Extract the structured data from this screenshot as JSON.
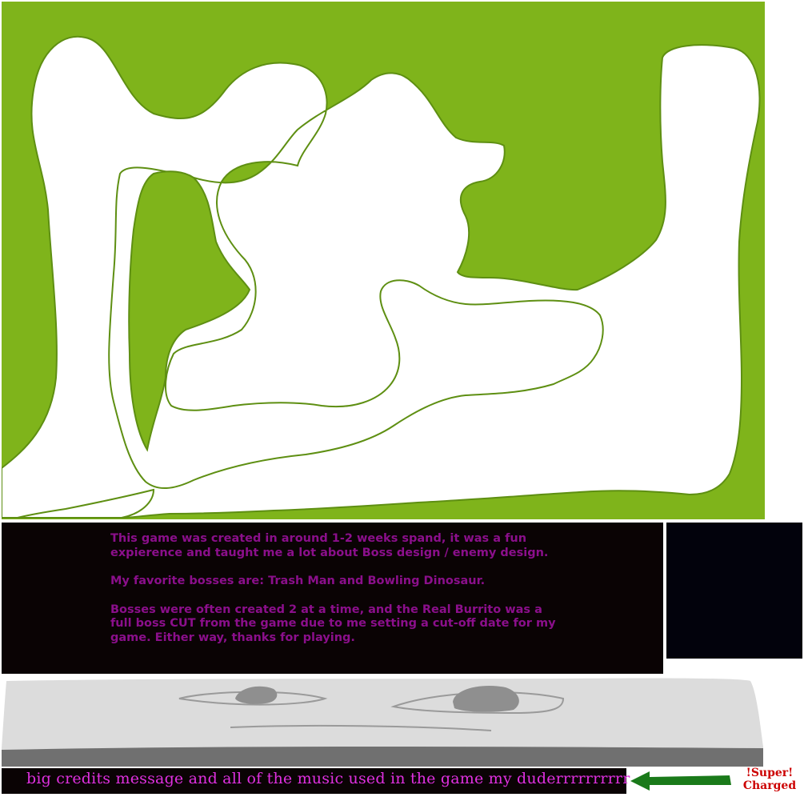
{
  "colors": {
    "grass": "#7fb41b",
    "path": "#ffffff",
    "panel": "#0a0304",
    "message_text": "#8b0f8b",
    "credits_text": "#e030e0",
    "arrow": "#1a7a1a",
    "badge": "#cc0000"
  },
  "level": {
    "name": "level-maze-map",
    "terrain": "green grass with white winding path"
  },
  "message": {
    "paragraph_1": "This game was created in around 1-2 weeks spand, it was a fun expierence and taught me a lot about Boss design / enemy design.",
    "paragraph_2": "My favorite bosses are: Trash Man and Bowling Dinosaur.",
    "paragraph_3": "Bosses were often created 2 at a time, and the Real Burrito was a full boss CUT from the game due to me setting a cut-off date for my game. Either way, thanks for playing."
  },
  "credits": {
    "text": "big credits message and all of the music used in the game my duderrrrrrrrrr"
  },
  "badge": {
    "line1": "!Super!",
    "line2": "Charged"
  },
  "icons": {
    "arrow": "left-arrow-icon",
    "face": "sleepy-face-sprite"
  }
}
